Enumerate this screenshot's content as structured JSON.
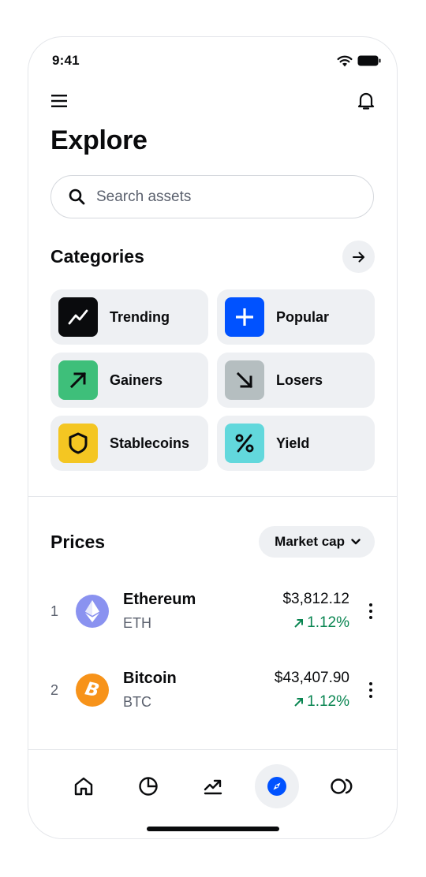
{
  "status": {
    "time": "9:41"
  },
  "header": {
    "title": "Explore"
  },
  "search": {
    "placeholder": "Search assets"
  },
  "categories": {
    "title": "Categories",
    "items": [
      {
        "label": "Trending",
        "color": "#0a0b0d",
        "icon": "trending-icon"
      },
      {
        "label": "Popular",
        "color": "#0052ff",
        "icon": "plus-icon"
      },
      {
        "label": "Gainers",
        "color": "#3ebf7a",
        "icon": "arrow-up-right-icon"
      },
      {
        "label": "Losers",
        "color": "#b5bec0",
        "icon": "arrow-down-right-icon"
      },
      {
        "label": "Stablecoins",
        "color": "#f4c622",
        "icon": "shield-icon"
      },
      {
        "label": "Yield",
        "color": "#62d8dc",
        "icon": "percent-icon"
      }
    ]
  },
  "prices": {
    "title": "Prices",
    "sort_label": "Market cap",
    "rows": [
      {
        "rank": "1",
        "name": "Ethereum",
        "symbol": "ETH",
        "price": "$3,812.12",
        "change": "1.12%",
        "icon": "ethereum-icon",
        "color": "#8a92f0"
      },
      {
        "rank": "2",
        "name": "Bitcoin",
        "symbol": "BTC",
        "price": "$43,407.90",
        "change": "1.12%",
        "icon": "bitcoin-icon",
        "color": "#f7931a"
      }
    ]
  },
  "tabs": [
    {
      "name": "home",
      "icon": "home-icon"
    },
    {
      "name": "portfolio",
      "icon": "pie-chart-icon"
    },
    {
      "name": "trade",
      "icon": "trend-chart-icon"
    },
    {
      "name": "explore",
      "icon": "compass-icon",
      "active": true
    },
    {
      "name": "web3",
      "icon": "web3-icon"
    }
  ],
  "colors": {
    "accent": "#0052ff",
    "positive": "#098551",
    "muted": "#5b616e",
    "surface": "#eef0f3"
  }
}
